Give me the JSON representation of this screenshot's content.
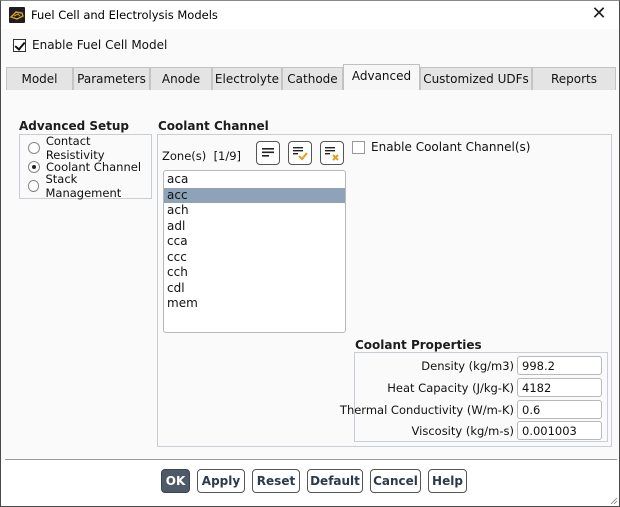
{
  "window": {
    "title": "Fuel Cell and Electrolysis Models",
    "close_icon": "close-icon",
    "app_icon": "fluent-app-icon"
  },
  "enable_fuel_cell": {
    "label": "Enable Fuel Cell Model",
    "checked": true
  },
  "tabs": [
    {
      "label": "Model",
      "active": false
    },
    {
      "label": "Parameters",
      "active": false
    },
    {
      "label": "Anode",
      "active": false
    },
    {
      "label": "Electrolyte",
      "active": false
    },
    {
      "label": "Cathode",
      "active": false
    },
    {
      "label": "Advanced",
      "active": true
    },
    {
      "label": "Customized UDFs",
      "active": false
    },
    {
      "label": "Reports",
      "active": false
    }
  ],
  "advanced_setup": {
    "title": "Advanced Setup",
    "options": [
      {
        "label": "Contact Resistivity",
        "selected": false
      },
      {
        "label": "Coolant Channel",
        "selected": true
      },
      {
        "label": "Stack Management",
        "selected": false
      }
    ]
  },
  "coolant_channel": {
    "title": "Coolant Channel",
    "zones_label": "Zone(s)",
    "zones_count": "[1/9]",
    "tool_icons": [
      "select-all-icon",
      "select-check-icon",
      "deselect-all-icon"
    ],
    "zones": [
      {
        "name": "aca",
        "selected": false
      },
      {
        "name": "acc",
        "selected": true
      },
      {
        "name": "ach",
        "selected": false
      },
      {
        "name": "adl",
        "selected": false
      },
      {
        "name": "cca",
        "selected": false
      },
      {
        "name": "ccc",
        "selected": false
      },
      {
        "name": "cch",
        "selected": false
      },
      {
        "name": "cdl",
        "selected": false
      },
      {
        "name": "mem",
        "selected": false
      }
    ],
    "enable_label": "Enable Coolant Channel(s)",
    "enable_checked": false
  },
  "coolant_properties": {
    "title": "Coolant Properties",
    "fields": [
      {
        "label": "Density (kg/m3)",
        "value": "998.2"
      },
      {
        "label": "Heat Capacity (J/kg-K)",
        "value": "4182"
      },
      {
        "label": "Thermal Conductivity (W/m-K)",
        "value": "0.6"
      },
      {
        "label": "Viscosity (kg/m-s)",
        "value": "0.001003"
      }
    ]
  },
  "buttons": {
    "ok": "OK",
    "apply": "Apply",
    "reset": "Reset",
    "default": "Default",
    "cancel": "Cancel",
    "help": "Help"
  },
  "colors": {
    "selection": "#8ea3b8",
    "primary_button": "#4f5a68",
    "accent_icon": "#e0a020"
  }
}
